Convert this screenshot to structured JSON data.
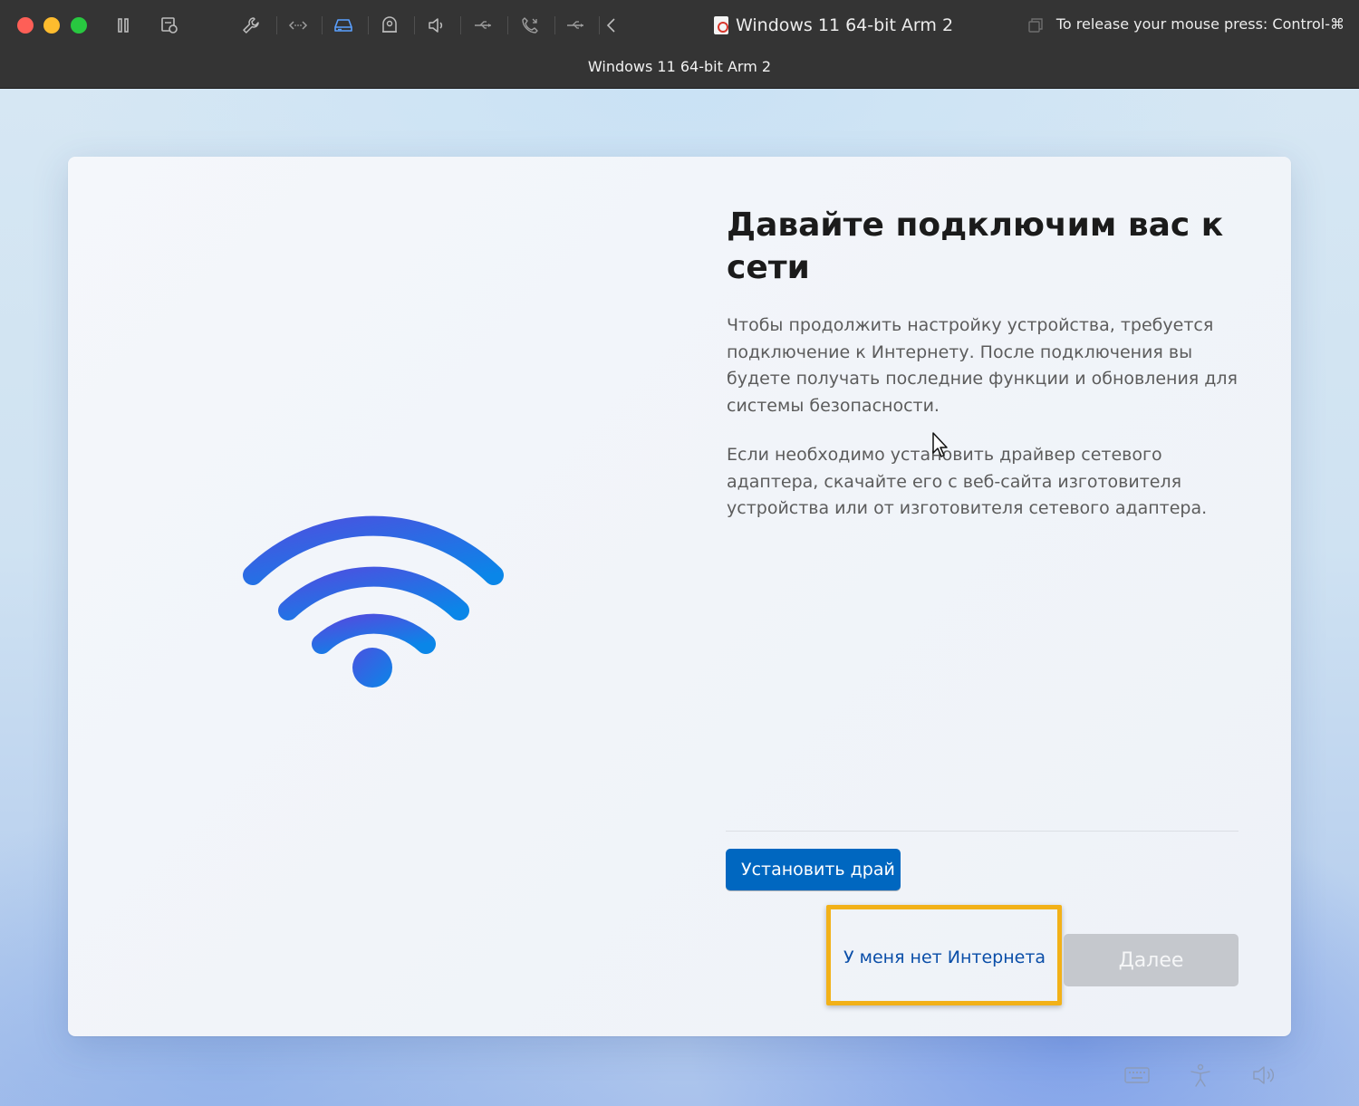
{
  "window": {
    "vm_title": "Windows 11 64-bit Arm 2",
    "release_hint": "To release your mouse press: Control-⌘",
    "subtitle": "Windows 11 64-bit Arm 2"
  },
  "toolbar": {
    "icons": [
      "pause-icon",
      "snapshot-icon",
      "settings-wrench-icon",
      "network-icon",
      "hard-disk-icon",
      "camera-icon",
      "sound-icon",
      "usb-icon",
      "phone-icon",
      "usb-icon",
      "collapse-chevron-icon"
    ]
  },
  "oobe": {
    "title": "Давайте подключим вас к сети",
    "paragraph_1": "Чтобы продолжить настройку устройства, требуется подключение к Интернету. После подключения вы будете получать последние функции и обновления для системы безопасности.",
    "paragraph_2": "Если необходимо установить драйвер сетевого адаптера, скачайте его с веб-сайта изготовителя устройства или от изготовителя сетевого адаптера.",
    "install_driver_label": "Установить драй",
    "no_internet_label": "У меня нет Интернета",
    "next_label": "Далее"
  },
  "colors": {
    "accent_button": "#0067c0",
    "highlight_frame": "#f2b118",
    "disabled_button": "#c5c8cd",
    "wifi_gradient_start": "#4a52e0",
    "wifi_gradient_end": "#0a86e8"
  },
  "tray": {
    "icons": [
      "keyboard-icon",
      "accessibility-icon",
      "volume-icon"
    ]
  }
}
